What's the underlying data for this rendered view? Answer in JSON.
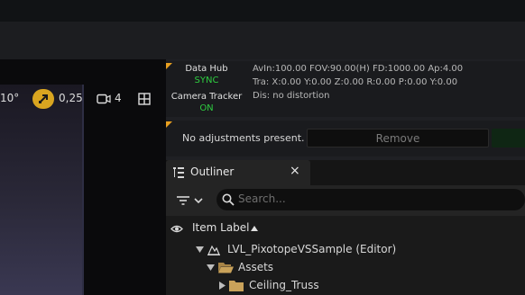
{
  "viewport": {
    "fov_partial": "10°",
    "snap_value": "0,25",
    "camera_speed": "4"
  },
  "data_hub": {
    "title": "Data Hub",
    "status": "SYNC",
    "camera_tracker_label": "Camera Tracker",
    "camera_tracker_status": "ON",
    "line1": "AvIn:100.00 FOV:90.00(H) FD:1000.00 Ap:4.00",
    "line2": "Tra: X:0.00 Y:0.00 Z:0.00 R:0.00 P:0.00 Y:0.00",
    "line3": "Dis: no distortion",
    "status_color": "#2ecc40"
  },
  "adjustments": {
    "message": "No adjustments present.",
    "remove_label": "Remove"
  },
  "outliner": {
    "tab_label": "Outliner",
    "search_placeholder": "Search...",
    "column_header": "Item Label",
    "items": [
      {
        "label": "LVL_PixotopeVSSample (Editor)",
        "icon": "level-icon"
      },
      {
        "label": "Assets",
        "icon": "folder-open-icon"
      },
      {
        "label": "Ceiling_Truss",
        "icon": "folder-icon"
      }
    ]
  },
  "colors": {
    "accent": "#d9a520",
    "folder": "#c9a25a"
  }
}
